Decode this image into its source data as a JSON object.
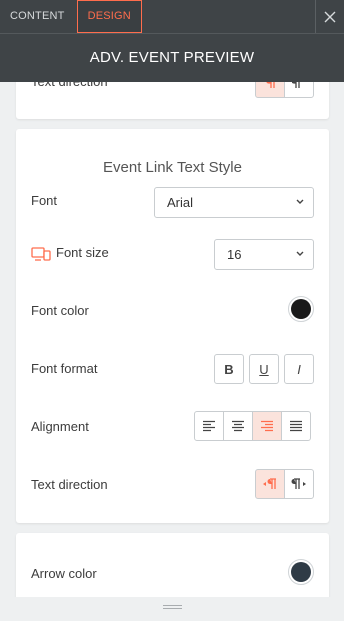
{
  "tabs": [
    {
      "label": "CONTENT"
    },
    {
      "label": "DESIGN"
    }
  ],
  "header": {
    "title": "ADV. EVENT PREVIEW"
  },
  "top_card": {
    "label": "Text direction"
  },
  "link_style": {
    "title": "Event Link Text Style",
    "font": {
      "label": "Font",
      "value": "Arial"
    },
    "font_size": {
      "label": "Font size",
      "value": "16"
    },
    "font_color": {
      "label": "Font color",
      "color": "#1a1a1a"
    },
    "font_format": {
      "label": "Font format",
      "buttons": [
        "B",
        "U",
        "I"
      ]
    },
    "alignment": {
      "label": "Alignment",
      "options": [
        "align-left",
        "align-center",
        "align-right",
        "justify"
      ],
      "active": "align-right"
    },
    "text_direction": {
      "label": "Text direction",
      "options": [
        "ltr",
        "rtl"
      ],
      "active": "ltr"
    }
  },
  "arrow": {
    "label": "Arrow color",
    "color": "#2f3b46"
  },
  "colors": {
    "accent": "#ff6d4d",
    "header_bg": "#3f4447"
  }
}
